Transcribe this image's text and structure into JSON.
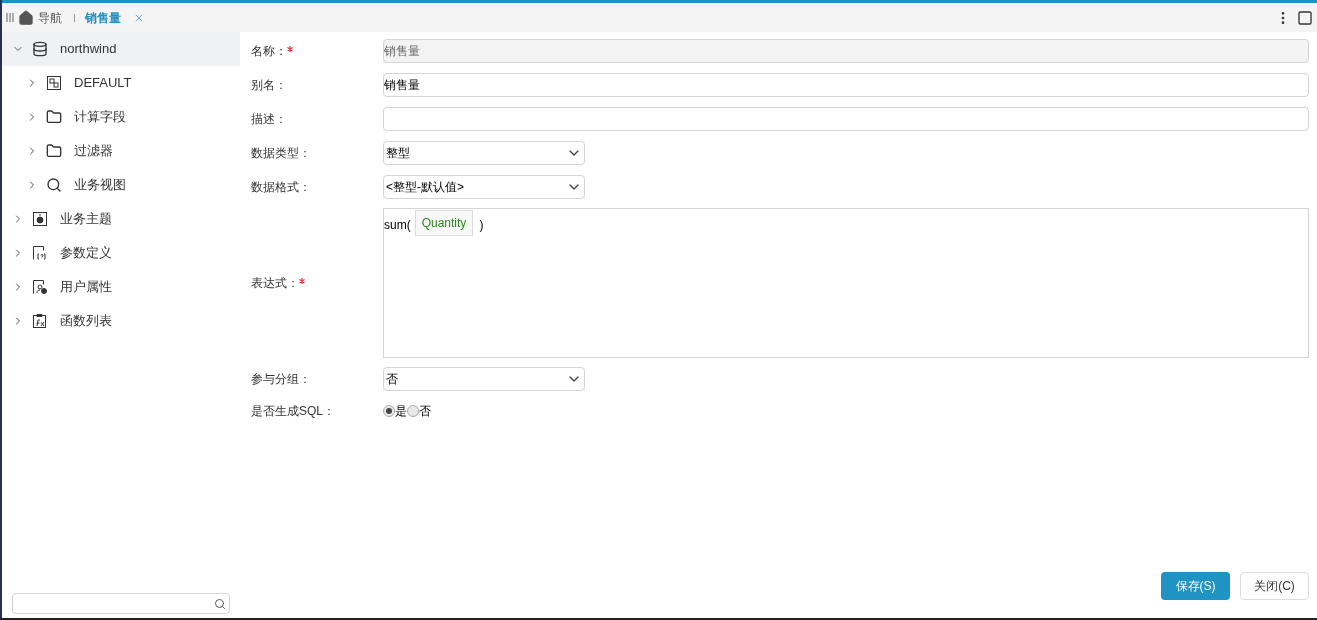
{
  "tabs": [
    {
      "label": "导航",
      "kind": "home",
      "selected": false
    },
    {
      "label": "销售量",
      "kind": "doc",
      "selected": true
    }
  ],
  "tree": [
    {
      "label": "northwind",
      "kind": "database",
      "expanded": true,
      "selected": true,
      "children": [
        {
          "label": "DEFAULT",
          "kind": "schema",
          "expanded": false,
          "selected": false
        },
        {
          "label": "计算字段",
          "kind": "folder",
          "expanded": false,
          "selected": false
        },
        {
          "label": "过滤器",
          "kind": "folder",
          "expanded": false,
          "selected": false
        },
        {
          "label": "业务视图",
          "kind": "view",
          "expanded": false,
          "selected": false
        }
      ]
    },
    {
      "label": "业务主题",
      "kind": "topic",
      "expanded": false,
      "selected": false
    },
    {
      "label": "参数定义",
      "kind": "param",
      "expanded": false,
      "selected": false
    },
    {
      "label": "用户属性",
      "kind": "user",
      "expanded": false,
      "selected": false
    },
    {
      "label": "函数列表",
      "kind": "function",
      "expanded": false,
      "selected": false
    }
  ],
  "form": [
    {
      "kind": "text",
      "label": "名称：",
      "required": true,
      "value": "销售量",
      "disabled": true
    },
    {
      "kind": "text",
      "label": "别名：",
      "required": false,
      "value": "销售量",
      "disabled": false
    },
    {
      "kind": "text",
      "label": "描述：",
      "required": false,
      "disabled": false
    },
    {
      "kind": "select",
      "label": "数据类型：",
      "required": false,
      "value": "整型"
    },
    {
      "kind": "select",
      "label": "数据格式：",
      "required": false,
      "value": "<整型-默认值>"
    },
    {
      "kind": "expression",
      "label": "表达式：",
      "required": true,
      "before": "sum(",
      "token": "Quantity",
      "after": ")"
    },
    {
      "kind": "select",
      "label": "参与分组：",
      "required": false,
      "value": "否"
    },
    {
      "kind": "radio",
      "label": "是否生成SQL：",
      "required": false,
      "options": [
        {
          "label": "是",
          "selected": true
        },
        {
          "label": "否",
          "selected": false
        }
      ]
    }
  ],
  "buttons": [
    {
      "label": "保存(S)",
      "primary": true
    },
    {
      "label": "关闭(C)",
      "primary": false
    }
  ]
}
